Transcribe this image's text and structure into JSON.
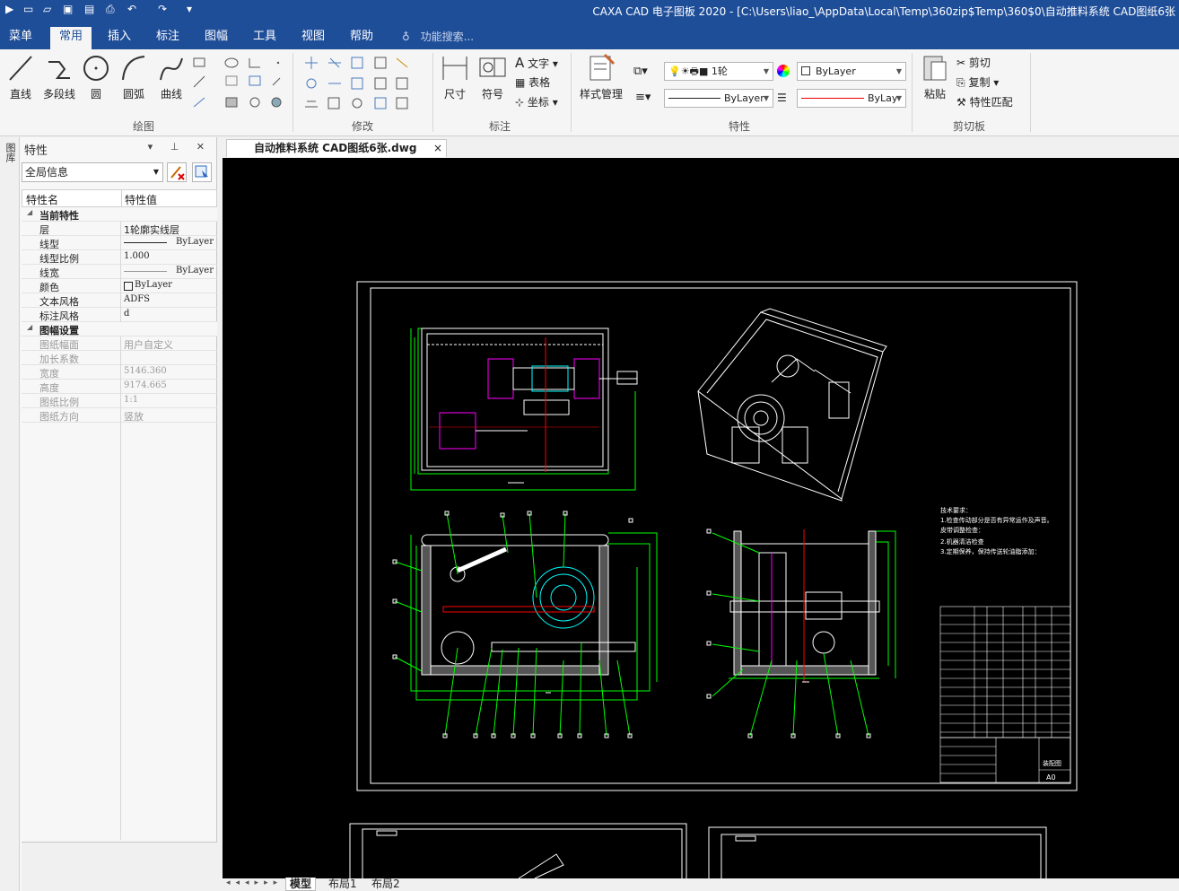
{
  "titlebar": {
    "title": "CAXA CAD 电子图板 2020 - [C:\\Users\\liao_\\AppData\\Local\\Temp\\360zip$Temp\\360$0\\自动推料系统 CAD图纸6张"
  },
  "menu": {
    "tabs": [
      "菜单",
      "常用",
      "插入",
      "标注",
      "图幅",
      "工具",
      "视图",
      "帮助"
    ],
    "active_index": 1,
    "search_placeholder": "功能搜索..."
  },
  "ribbon": {
    "draw": {
      "group_label": "绘图",
      "line": "直线",
      "polyline": "多段线",
      "circle": "圆",
      "arc": "圆弧",
      "curve": "曲线"
    },
    "modify": {
      "group_label": "修改"
    },
    "annotate": {
      "group_label": "标注",
      "dimension": "尺寸",
      "symbol": "符号",
      "text": "文字",
      "table": "表格",
      "coordinate": "坐标"
    },
    "style": {
      "style_manage": "样式管理"
    },
    "properties": {
      "group_label": "特性",
      "layer_combo": "1轮",
      "color_combo": "ByLayer",
      "linetype_combo": "ByLayer",
      "linewidth_combo": "ByLay"
    },
    "clipboard": {
      "group_label": "剪切板",
      "paste": "粘贴",
      "cut": "剪切",
      "copy": "复制",
      "match": "特性匹配"
    }
  },
  "side_strip": {
    "label": "图库"
  },
  "properties_panel": {
    "title": "特性",
    "scope": "全局信息",
    "col_name": "特性名",
    "col_value": "特性值",
    "sections": [
      {
        "title": "当前特性",
        "rows": [
          {
            "name": "层",
            "value": "1轮廓实线层"
          },
          {
            "name": "线型",
            "value": "ByLayer"
          },
          {
            "name": "线型比例",
            "value": "1.000"
          },
          {
            "name": "线宽",
            "value": "ByLayer"
          },
          {
            "name": "颜色",
            "value": "ByLayer"
          },
          {
            "name": "文本风格",
            "value": "ADFS"
          },
          {
            "name": "标注风格",
            "value": "d"
          }
        ]
      },
      {
        "title": "图幅设置",
        "rows": [
          {
            "name": "图纸幅面",
            "value": "用户自定义"
          },
          {
            "name": "加长系数",
            "value": ""
          },
          {
            "name": "宽度",
            "value": "5146.360"
          },
          {
            "name": "高度",
            "value": "9174.665"
          },
          {
            "name": "图纸比例",
            "value": "1:1"
          },
          {
            "name": "图纸方向",
            "value": "竖放"
          }
        ]
      }
    ]
  },
  "document": {
    "tab_label": "自动推料系统 CAD图纸6张.dwg",
    "close": "×"
  },
  "drawing": {
    "tech_notes": [
      "技术要求：",
      "1.检查传动部分是否有异常运作及声音。",
      "皮带调整检查：",
      "2.机器清洁检查",
      "3.定期保养，保持传送轮油脂添加："
    ],
    "sheet_size": "A0",
    "title_block_label": "装配图"
  },
  "layout_tabs": {
    "tabs": [
      "模型",
      "布局1",
      "布局2"
    ],
    "active_index": 0,
    "nav": "◂◂◂▸▸▸"
  },
  "colors": {
    "title_bg": "#1f4e99",
    "canvas_bg": "#000000",
    "cad_green": "#00ff00",
    "cad_white": "#ffffff",
    "cad_red": "#ff0000",
    "cad_magenta": "#ff00ff",
    "cad_cyan": "#00ffff"
  }
}
